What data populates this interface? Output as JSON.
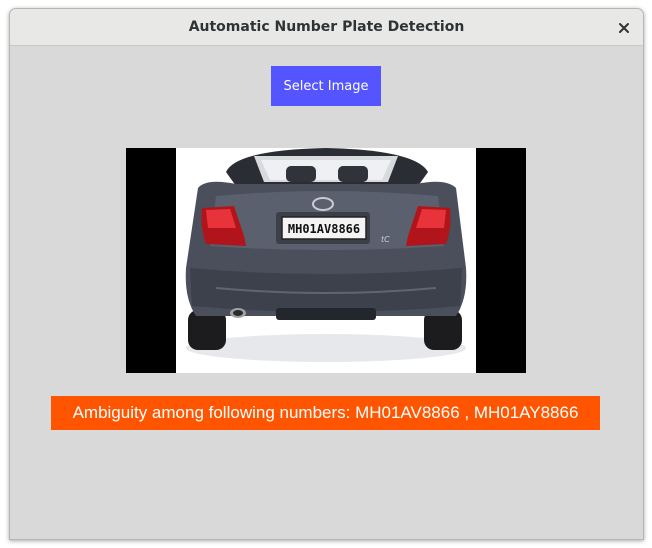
{
  "window": {
    "title": "Automatic Number Plate Detection",
    "close_icon": "close-icon"
  },
  "toolbar": {
    "select_image_label": "Select Image"
  },
  "preview": {
    "plate_text": "MH01AV8866",
    "badge_text": "tC"
  },
  "result": {
    "text": "Ambiguity among following numbers: MH01AV8866 , MH01AY8866"
  },
  "colors": {
    "button_bg": "#5555ff",
    "result_bg": "#ff5500",
    "window_bg": "#d9d9d9",
    "titlebar_bg": "#e8e8e7"
  }
}
